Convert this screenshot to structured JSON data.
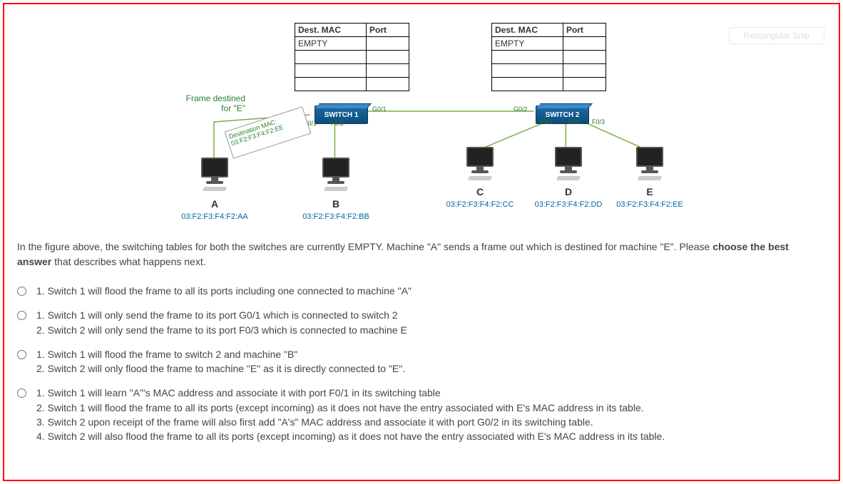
{
  "mac_tables": {
    "left": {
      "header": {
        "mac": "Dest. MAC",
        "port": "Port"
      },
      "row1": "EMPTY"
    },
    "right": {
      "header": {
        "mac": "Dest. MAC",
        "port": "Port"
      },
      "row1": "EMPTY"
    }
  },
  "switches": {
    "s1": "SWITCH 1",
    "s2": "SWITCH 2"
  },
  "ports": {
    "s1_f01": "F0/1",
    "s1_f02": "F0/2",
    "s1_g01": "G0/1",
    "s2_g02": "G0/2",
    "s2_f01": "F0/1",
    "s2_f02": "F0/2",
    "s2_f03": "F0/3"
  },
  "hosts": {
    "A": {
      "label": "A",
      "mac": "03:F2:F3:F4:F2:AA"
    },
    "B": {
      "label": "B",
      "mac": "03:F2:F3:F4:F2:BB"
    },
    "C": {
      "label": "C",
      "mac": "03:F2:F3:F4:F2:CC"
    },
    "D": {
      "label": "D",
      "mac": "03:F2:F3:F4:F2:DD"
    },
    "E": {
      "label": "E",
      "mac": "03:F2:F3:F4:F2:EE"
    }
  },
  "annotation": {
    "frame_dest": "Frame destined\nfor \"E\"",
    "frame_dest_l1": "Frame destined",
    "frame_dest_l2": "for \"E\"",
    "box_l1": "Destination MAC:",
    "box_l2": "03:F2:F3:F4:F2:EE"
  },
  "watermark": "Rectangular Snip",
  "question": {
    "pre": "In the figure above, the switching tables for both the switches are currently EMPTY. Machine \"A\" sends a frame out which is destined for machine \"E\". Please ",
    "bold": "choose the best answer",
    "post": " that describes what happens next."
  },
  "options": [
    {
      "lines": [
        "1. Switch 1 will flood the frame to all its ports including one connected to machine \"A\""
      ]
    },
    {
      "lines": [
        "1. Switch 1 will only send the frame to its port G0/1 which is connected to switch 2",
        "2. Switch 2 will only send the frame to its port  F0/3 which is connected to machine E"
      ]
    },
    {
      "lines": [
        "1. Switch 1 will flood the frame to switch 2 and machine \"B\"",
        "2. Switch 2 will only flood the frame to machine \"E\" as it is directly connected to \"E\"."
      ]
    },
    {
      "lines": [
        "1. Switch 1 will learn \"A\"'s MAC address and associate it with port F0/1 in its switching table",
        "2. Switch 1 will flood the frame to all its ports (except incoming) as it does not have the entry associated with E's MAC address in its table.",
        "3. Switch 2 upon receipt of the frame will also first add \"A's\" MAC address and associate it with port G0/2 in its switching table.",
        "4. Switch 2 will also flood the frame to all its ports (except incoming) as it does not have the entry associated with E's MAC address in its table."
      ]
    }
  ]
}
